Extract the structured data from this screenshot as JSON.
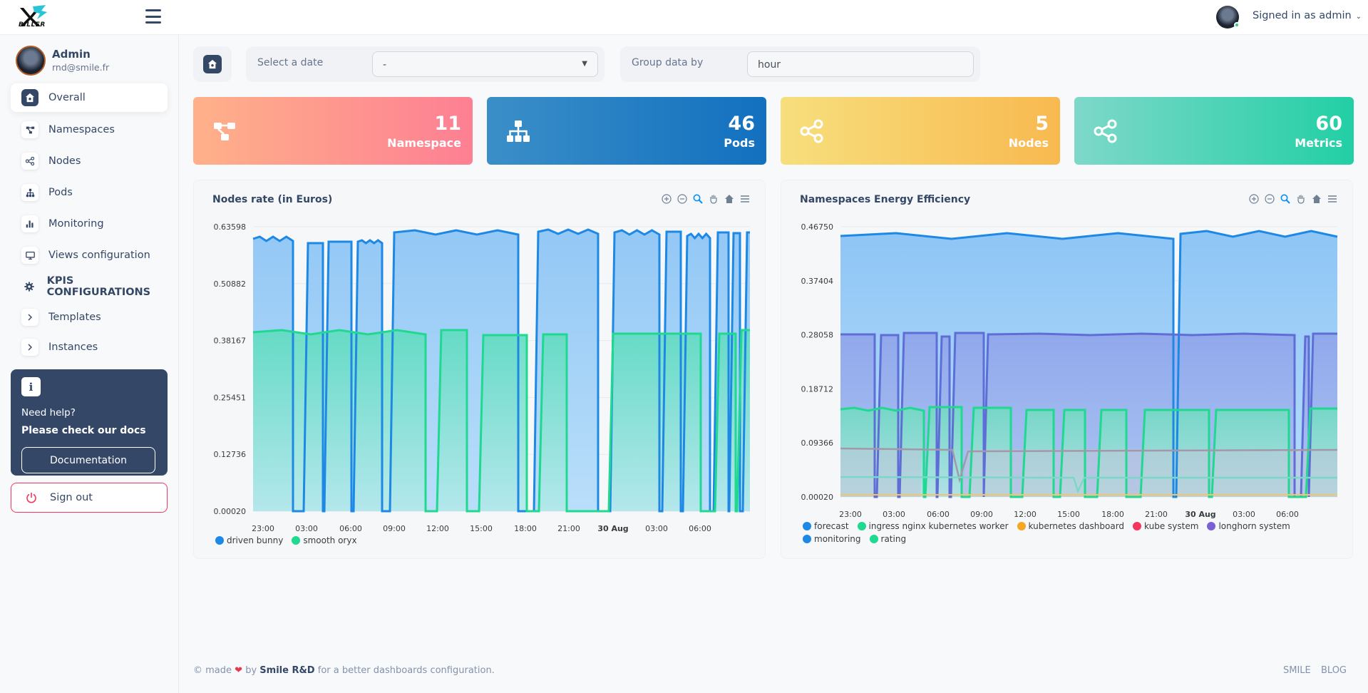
{
  "app": {
    "logo_text": "BILLER",
    "signed_in_label": "Signed in as admin"
  },
  "sidebar": {
    "user_name": "Admin",
    "user_email": "rnd@smile.fr",
    "items": [
      {
        "label": "Overall",
        "icon": "home-icon",
        "active": true
      },
      {
        "label": "Namespaces",
        "icon": "namespace-icon"
      },
      {
        "label": "Nodes",
        "icon": "share-icon"
      },
      {
        "label": "Pods",
        "icon": "sitemap-icon"
      },
      {
        "label": "Monitoring",
        "icon": "bar-chart-icon"
      },
      {
        "label": "Views configuration",
        "icon": "monitor-icon"
      },
      {
        "label": "KPIS CONFIGURATIONS",
        "icon": "gear-icon"
      },
      {
        "label": "Templates",
        "icon": "chevron-right-icon"
      },
      {
        "label": "Instances",
        "icon": "chevron-right-icon"
      }
    ],
    "help": {
      "line1": "Need help?",
      "line2": "Please check our docs",
      "button": "Documentation"
    },
    "signout": "Sign out"
  },
  "filters": {
    "date_label": "Select a date",
    "date_value": "-",
    "group_label": "Group data by",
    "group_value": "hour"
  },
  "stats": [
    {
      "value": "11",
      "label": "Namespace",
      "color_from": "#ffab8a",
      "color_to": "#fd7f93"
    },
    {
      "value": "46",
      "label": "Pods",
      "color_from": "#3a8fc9",
      "color_to": "#1171c0"
    },
    {
      "value": "5",
      "label": "Nodes",
      "color_from": "#f7de7b",
      "color_to": "#f9bb52"
    },
    {
      "value": "60",
      "label": "Metrics",
      "color_from": "#7cd9c9",
      "color_to": "#23cfa6"
    }
  ],
  "charts": {
    "nodes_rate": {
      "title": "Nodes rate (in Euros)",
      "y_ticks": [
        "0.63598",
        "0.50882",
        "0.38167",
        "0.25451",
        "0.12736",
        "0.00020"
      ],
      "x_ticks": [
        "23:00",
        "03:00",
        "06:00",
        "09:00",
        "12:00",
        "15:00",
        "18:00",
        "21:00",
        "30 Aug",
        "03:00",
        "06:00"
      ],
      "legend": [
        {
          "name": "driven bunny",
          "color": "#1e88e5"
        },
        {
          "name": "smooth oryx",
          "color": "#1ed98f"
        }
      ]
    },
    "energy": {
      "title": "Namespaces Energy Efficiency",
      "y_ticks": [
        "0.46750",
        "0.37404",
        "0.28058",
        "0.18712",
        "0.09366",
        "0.00020"
      ],
      "x_ticks": [
        "23:00",
        "03:00",
        "06:00",
        "09:00",
        "12:00",
        "15:00",
        "18:00",
        "21:00",
        "30 Aug",
        "03:00",
        "06:00"
      ],
      "legend": [
        {
          "name": "forecast",
          "color": "#1e88e5"
        },
        {
          "name": "ingress nginx kubernetes worker",
          "color": "#1ed98f"
        },
        {
          "name": "kubernetes dashboard",
          "color": "#f5a623"
        },
        {
          "name": "kube system",
          "color": "#f5365c"
        },
        {
          "name": "longhorn system",
          "color": "#7b5fd6"
        },
        {
          "name": "monitoring",
          "color": "#1e88e5"
        },
        {
          "name": "rating",
          "color": "#1ed98f"
        }
      ]
    }
  },
  "footer": {
    "made": "© made",
    "by": "by",
    "brand": "Smile R&D",
    "tail": "for a better dashboards configuration.",
    "link1": "SMILE",
    "link2": "BLOG"
  }
}
